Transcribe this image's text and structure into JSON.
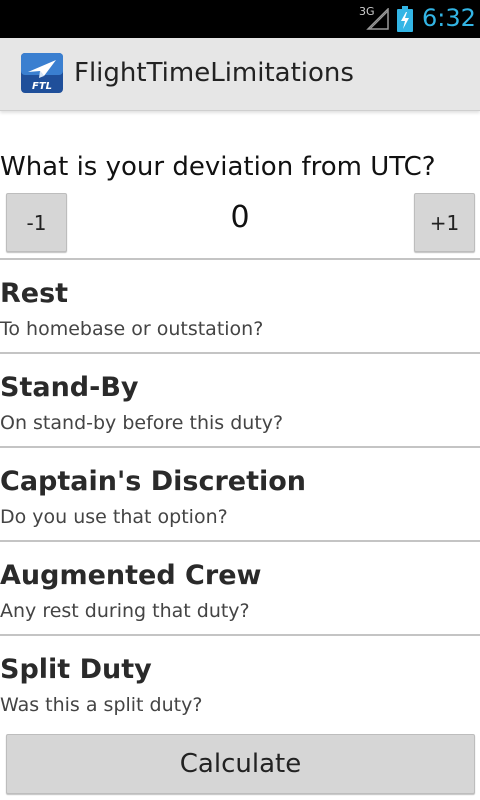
{
  "status_bar": {
    "network": "3G",
    "time": "6:32",
    "clock_color": "#33b5e5"
  },
  "action_bar": {
    "app_icon_text": "FTL",
    "title": "FlightTimeLimitations"
  },
  "utc": {
    "question": "What is your deviation from UTC?",
    "decrement_label": "-1",
    "value": "0",
    "increment_label": "+1"
  },
  "options": [
    {
      "title": "Rest",
      "subtitle": "To homebase or outstation?"
    },
    {
      "title": "Stand-By",
      "subtitle": "On stand-by before this duty?"
    },
    {
      "title": "Captain's Discretion",
      "subtitle": "Do you use that option?"
    },
    {
      "title": "Augmented Crew",
      "subtitle": "Any rest during that duty?"
    },
    {
      "title": "Split Duty",
      "subtitle": "Was this a split duty?"
    }
  ],
  "calculate_label": "Calculate"
}
